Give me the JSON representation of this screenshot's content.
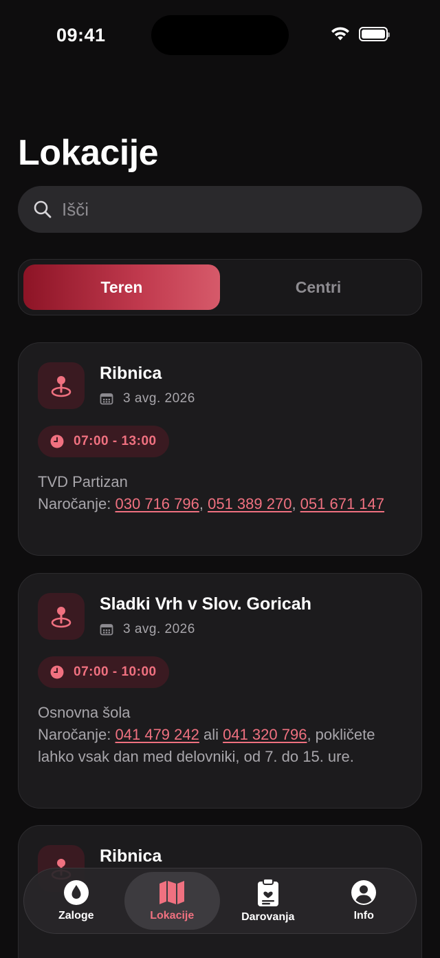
{
  "status": {
    "time": "09:41"
  },
  "title": "Lokacije",
  "search": {
    "placeholder": "Išči"
  },
  "segments": [
    {
      "label": "Teren",
      "active": true
    },
    {
      "label": "Centri",
      "active": false
    }
  ],
  "cards": [
    {
      "title": "Ribnica",
      "date": "3 avg. 2026",
      "time": "07:00 - 13:00",
      "venue": "TVD Partizan",
      "booking_label": "Naročanje:",
      "phones": [
        "030 716 796",
        "051 389 270",
        "051 671 147"
      ],
      "separators": [
        ", ",
        ", "
      ]
    },
    {
      "title": "Sladki Vrh v Slov. Goricah",
      "date": "3 avg. 2026",
      "time": "07:00 - 10:00",
      "venue": "Osnovna šola",
      "booking_label": "Naročanje:",
      "phones": [
        "041 479 242",
        "041 320 796"
      ],
      "separators": [
        " ali "
      ],
      "note": ", pokličete lahko vsak dan med delovniki, od 7. do 15. ure."
    },
    {
      "title": "Ribnica"
    }
  ],
  "tabs": [
    {
      "label": "Zaloge",
      "icon": "drop-icon",
      "active": false
    },
    {
      "label": "Lokacije",
      "icon": "map-icon",
      "active": true
    },
    {
      "label": "Darovanja",
      "icon": "clipboard-icon",
      "active": false
    },
    {
      "label": "Info",
      "icon": "person-icon",
      "active": false
    }
  ],
  "colors": {
    "accent": "#f07180",
    "accent_dark": "#8d1426",
    "card": "#1c1b1d",
    "background": "#0e0d0e"
  }
}
